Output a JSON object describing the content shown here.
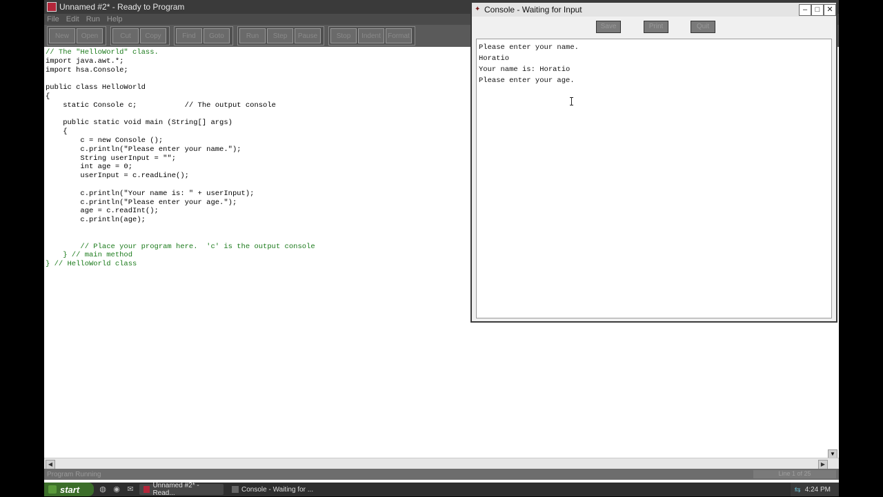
{
  "ide": {
    "title": "Unnamed #2* - Ready to Program",
    "menu": [
      "File",
      "Edit",
      "Run",
      "Help"
    ],
    "toolbar_groups": [
      [
        "New",
        "Open"
      ],
      [
        "Cut",
        "Copy"
      ],
      [
        "Find",
        "Goto"
      ],
      [
        "Run",
        "Step",
        "Pause"
      ],
      [
        "Stop",
        "Indent",
        "Format"
      ]
    ],
    "code_lines": [
      {
        "t": "// The \"HelloWorld\" class.",
        "c": "cm"
      },
      {
        "t": "import java.awt.*;"
      },
      {
        "t": "import hsa.Console;"
      },
      {
        "t": ""
      },
      {
        "t": "public class HelloWorld"
      },
      {
        "t": "{"
      },
      {
        "t": "    static Console c;           // The output console"
      },
      {
        "t": ""
      },
      {
        "t": "    public static void main (String[] args)"
      },
      {
        "t": "    {"
      },
      {
        "t": "        c = new Console ();"
      },
      {
        "t": "        c.println(\"Please enter your name.\");"
      },
      {
        "t": "        String userInput = \"\";"
      },
      {
        "t": "        int age = 0;"
      },
      {
        "t": "        userInput = c.readLine();"
      },
      {
        "t": ""
      },
      {
        "t": "        c.println(\"Your name is: \" + userInput);"
      },
      {
        "t": "        c.println(\"Please enter your age.\");"
      },
      {
        "t": "        age = c.readInt();"
      },
      {
        "t": "        c.println(age);"
      },
      {
        "t": ""
      },
      {
        "t": ""
      },
      {
        "t": "        // Place your program here.  'c' is the output console",
        "c": "cm"
      },
      {
        "t": "    } // main method",
        "c": "cm"
      },
      {
        "t": "} // HelloWorld class",
        "c": "cm"
      }
    ],
    "status_left": "Program Running",
    "status_right": "Line 1 of 25"
  },
  "console": {
    "title": "Console - Waiting for Input",
    "tools": [
      "Save",
      "Print",
      "Quit"
    ],
    "output": "Please enter your name.\nHoratio\nYour name is: Horatio\nPlease enter your age."
  },
  "taskbar": {
    "start_label": "start",
    "task_ide": "Unnamed #2* - Read...",
    "task_console": "Console - Waiting for ...",
    "clock": "4:24 PM"
  }
}
